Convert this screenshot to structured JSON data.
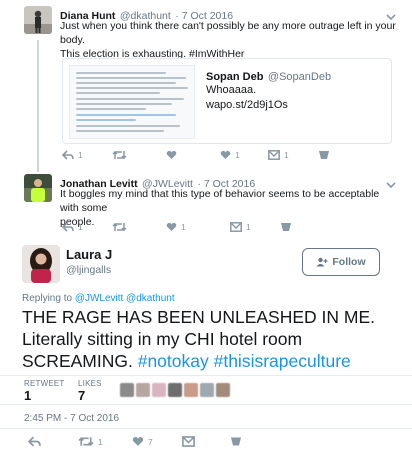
{
  "tweets": [
    {
      "name": "Diana Hunt",
      "handle": "@dkathunt",
      "time": "· 7 Oct 2016",
      "text_line1": "Just when you think there can't possibly be any more outrage left in your body.",
      "text_line2": "This election is exhausting. #ImWithHer",
      "quote": {
        "name": "Sopan Deb",
        "handle": "@SopanDeb",
        "text": "Whoaaaa.",
        "link": "wapo.st/2d9j1Os"
      },
      "actions": {
        "reply": "1",
        "like": "1",
        "dm": "1"
      }
    },
    {
      "name": "Jonathan Levitt",
      "handle": "@JWLevitt",
      "time": "· 7 Oct 2016",
      "text_line1": "It boggles my mind that this type of behavior seems to be acceptable with some",
      "text_line2": "people.",
      "actions": {
        "reply": "1",
        "like": "1",
        "dm": "1"
      }
    }
  ],
  "main": {
    "name": "Laura J",
    "handle": "@ljingalls",
    "follow_label": "Follow",
    "replying_prefix": "Replying to",
    "replying_handles": "@JWLevitt @dkathunt",
    "text_line1": "THE RAGE HAS BEEN UNLEASHED IN ME.",
    "text_line2": "Literally sitting in my CHI hotel room",
    "text_line3_plain": "SCREAMING. ",
    "hashtags": "#notokay #thisisrapeculture",
    "retweets_label": "RETWEET",
    "retweets_count": "1",
    "likes_label": "LIKES",
    "likes_count": "7",
    "timestamp": "2:45 PM - 7 Oct 2016",
    "actions": {
      "retweet": "1",
      "like": "7"
    }
  },
  "colors": {
    "link": "#1b95e0",
    "muted": "#657786",
    "icon": "#8899a6",
    "text": "#14171a"
  },
  "icons": [
    "reply-icon",
    "retweet-icon",
    "heart-icon",
    "dm-icon",
    "dropdown-chevron-icon",
    "add-user-icon"
  ]
}
